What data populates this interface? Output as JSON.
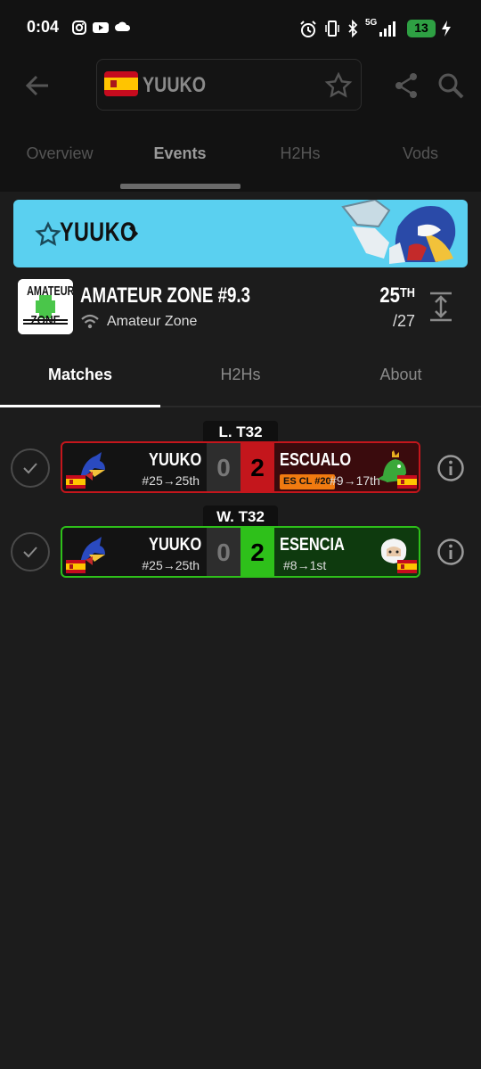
{
  "status_bar": {
    "time": "0:04",
    "battery": "13",
    "network": "5G"
  },
  "header": {
    "player_name": "YUUKO"
  },
  "top_tabs": [
    {
      "label": "Overview"
    },
    {
      "label": "Events"
    },
    {
      "label": "H2Hs"
    },
    {
      "label": "Vods"
    }
  ],
  "banner": {
    "player_name": "YUUKO",
    "color": "#5ad0f0"
  },
  "event": {
    "logo_line1": "AMATEUR",
    "logo_line2": "ZONE",
    "title": "AMATEUR ZONE #9.3",
    "organizer": "Amateur Zone",
    "placement": "25",
    "placement_suffix": "TH",
    "entrants": "/27"
  },
  "sub_tabs": [
    {
      "label": "Matches"
    },
    {
      "label": "H2Hs"
    },
    {
      "label": "About"
    }
  ],
  "matches": [
    {
      "round": "L. T32",
      "player": "YUUKO",
      "player_seed": "#25→25th",
      "player_score": "0",
      "opponent_score": "2",
      "opponent": "ESCUALO",
      "opponent_badge": "ES CL #20",
      "opponent_seed": "#9→17th",
      "result_color": "#c4161c"
    },
    {
      "round": "W. T32",
      "player": "YUUKO",
      "player_seed": "#25→25th",
      "player_score": "0",
      "opponent_score": "2",
      "opponent": "ESENCIA",
      "opponent_badge": "",
      "opponent_seed": "#8→1st",
      "result_color": "#2ec01a"
    }
  ]
}
